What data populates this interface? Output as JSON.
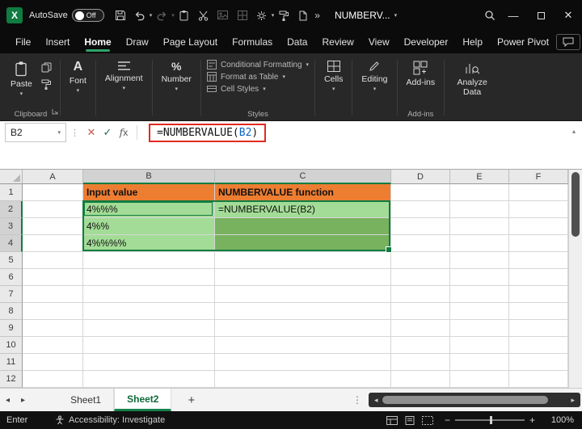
{
  "title_bar": {
    "autosave_label": "AutoSave",
    "autosave_state": "Off",
    "document_title": "NUMBERV..."
  },
  "menu": {
    "items": [
      "File",
      "Insert",
      "Home",
      "Draw",
      "Page Layout",
      "Formulas",
      "Data",
      "Review",
      "View",
      "Developer",
      "Help",
      "Power Pivot"
    ],
    "active": "Home"
  },
  "ribbon": {
    "paste": "Paste",
    "clipboard_group": "Clipboard",
    "font": "Font",
    "alignment": "Alignment",
    "number": "Number",
    "conditional_formatting": "Conditional Formatting",
    "format_as_table": "Format as Table",
    "cell_styles": "Cell Styles",
    "styles_group": "Styles",
    "cells": "Cells",
    "editing": "Editing",
    "addins": "Add-ins",
    "addins_group": "Add-ins",
    "analyze_data": "Analyze Data"
  },
  "formula_bar": {
    "name_box": "B2",
    "fx": "fx",
    "formula_prefix": "=NUMBERVALUE(",
    "formula_ref": "B2",
    "formula_suffix": ")"
  },
  "grid": {
    "columns": [
      "A",
      "B",
      "C",
      "D",
      "E",
      "F"
    ],
    "rows": [
      "1",
      "2",
      "3",
      "4",
      "5",
      "6",
      "7",
      "8",
      "9",
      "10",
      "11",
      "12"
    ],
    "cells": [
      {
        "ref": "B1",
        "text": "Input value",
        "fill": "orange",
        "bold": true
      },
      {
        "ref": "C1",
        "text": "NUMBERVALUE function",
        "fill": "orange",
        "bold": true
      },
      {
        "ref": "B2",
        "text": "4%%%",
        "fill": "light"
      },
      {
        "ref": "C2",
        "text": "=NUMBERVALUE(B2)",
        "fill": "light"
      },
      {
        "ref": "B3",
        "text": "4%%",
        "fill": "light"
      },
      {
        "ref": "C3",
        "text": "",
        "fill": "dark"
      },
      {
        "ref": "B4",
        "text": "4%%%%",
        "fill": "light"
      },
      {
        "ref": "C4",
        "text": "",
        "fill": "dark"
      }
    ],
    "selection": {
      "active": "B2",
      "start": "B2",
      "end": "C4"
    }
  },
  "sheet_tabs": {
    "tabs": [
      "Sheet1",
      "Sheet2"
    ],
    "active": "Sheet2"
  },
  "status_bar": {
    "mode": "Enter",
    "accessibility": "Accessibility: Investigate",
    "zoom": "100%"
  },
  "colors": {
    "excel_green": "#107C41",
    "menu_accent": "#2EA36B",
    "header_orange": "#ED7D31",
    "cell_light_green": "#A3DC96",
    "cell_dark_green": "#78B25F",
    "annotation_red": "#E02B20",
    "reference_blue": "#0B63C5"
  }
}
